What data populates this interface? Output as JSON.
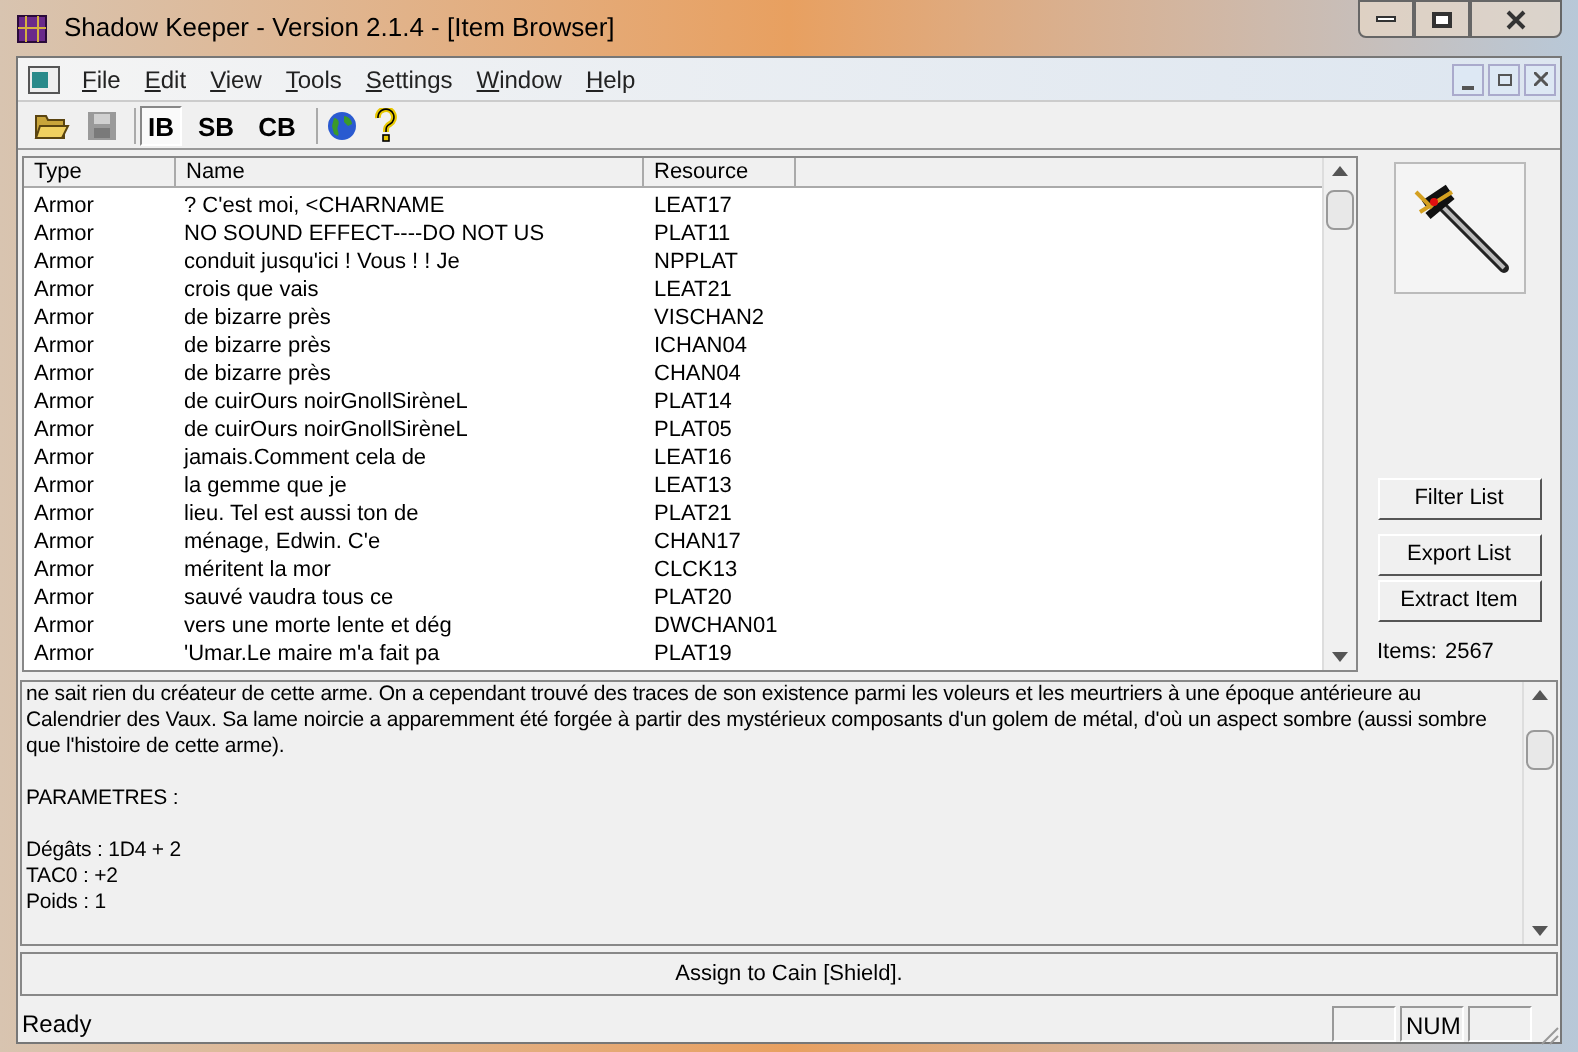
{
  "window": {
    "title": "Shadow Keeper - Version 2.1.4 - [Item Browser]"
  },
  "menu": [
    "File",
    "Edit",
    "View",
    "Tools",
    "Settings",
    "Window",
    "Help"
  ],
  "toolbar": [
    {
      "kind": "open"
    },
    {
      "kind": "save",
      "disabled": true
    },
    {
      "kind": "text",
      "label": "IB",
      "selected": true
    },
    {
      "kind": "text",
      "label": "SB",
      "selected": false
    },
    {
      "kind": "text",
      "label": "CB",
      "selected": false
    },
    {
      "kind": "globe"
    },
    {
      "kind": "help"
    }
  ],
  "table": {
    "columns": [
      "Type",
      "Name",
      "Resource"
    ],
    "rows": [
      [
        "Armor",
        "? C'est moi, <CHARNAME",
        "LEAT17"
      ],
      [
        "Armor",
        "NO SOUND EFFECT----DO NOT US",
        "PLAT11"
      ],
      [
        "Armor",
        "conduit jusqu'ici ! Vous ! ! Je",
        "NPPLAT"
      ],
      [
        "Armor",
        "crois que vais",
        "LEAT21"
      ],
      [
        "Armor",
        "de bizarre près",
        "VISCHAN2"
      ],
      [
        "Armor",
        "de bizarre près",
        "ICHAN04"
      ],
      [
        "Armor",
        "de bizarre près",
        "CHAN04"
      ],
      [
        "Armor",
        "de cuirOurs noirGnollSirèneL",
        "PLAT14"
      ],
      [
        "Armor",
        "de cuirOurs noirGnollSirèneL",
        "PLAT05"
      ],
      [
        "Armor",
        "jamais.Comment cela de",
        "LEAT16"
      ],
      [
        "Armor",
        "la gemme que je",
        "LEAT13"
      ],
      [
        "Armor",
        "lieu. Tel est aussi ton de",
        "PLAT21"
      ],
      [
        "Armor",
        "ménage, Edwin. C'e",
        "CHAN17"
      ],
      [
        "Armor",
        "méritent la mor",
        "CLCK13"
      ],
      [
        "Armor",
        "sauvé vaudra tous ce",
        "PLAT20"
      ],
      [
        "Armor",
        "vers une morte lente et dég",
        "DWCHAN01"
      ],
      [
        "Armor",
        "'Umar.Le maire m'a fait pa",
        "PLAT19"
      ]
    ]
  },
  "side_buttons": [
    "Filter List",
    "Export List",
    "Extract Item"
  ],
  "items_count": {
    "label": "Items:",
    "value": "2567"
  },
  "description": {
    "paragraphs": [
      "ne sait rien du créateur de cette arme. On a cependant trouvé des traces de son existence parmi les voleurs et les meurtriers à une époque antérieure au Calendrier des Vaux. Sa lame noircie a apparemment été forgée à partir des mystérieux composants d'un golem de métal, d'où un aspect sombre (aussi sombre que l'histoire de cette arme).",
      "PARAMETRES :"
    ],
    "stats": [
      "Dégâts : 1D4 + 2",
      "TAC0 : +2",
      "Poids : 1"
    ]
  },
  "assign_button": "Assign to Cain [Shield].",
  "status_bar": {
    "text": "Ready",
    "indicator": "NUM"
  }
}
